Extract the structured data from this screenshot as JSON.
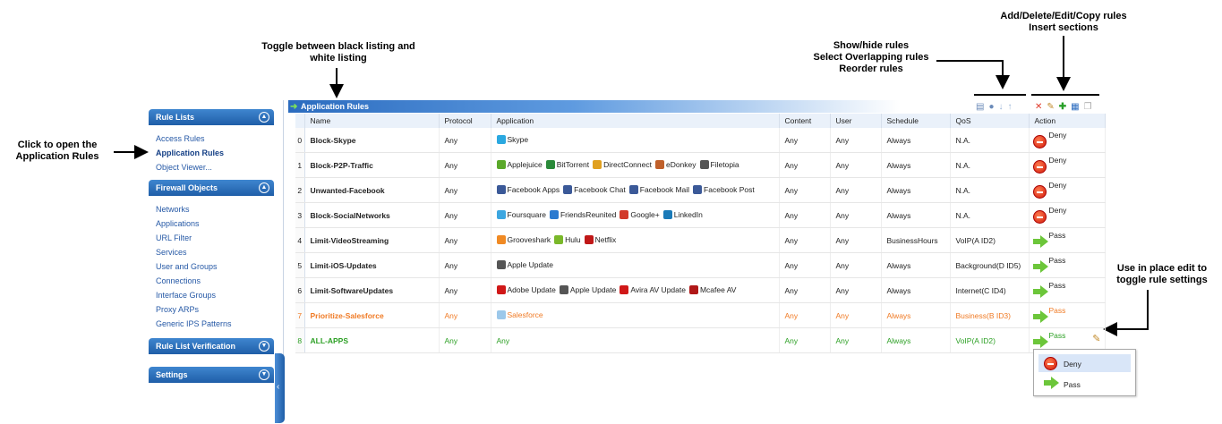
{
  "callouts": {
    "toggle_listing": "Toggle between black listing and white listing",
    "open_rules": "Click to open the Application Rules",
    "show_hide": "Show/hide rules",
    "select_overlap": "Select Overlapping rules",
    "reorder": "Reorder rules",
    "add_delete": "Add/Delete/Edit/Copy rules",
    "insert_sections": "Insert sections",
    "in_place_edit": "Use in place edit to toggle rule settings"
  },
  "sidebar": {
    "sections": [
      {
        "title": "Rule Lists",
        "items": [
          "Access Rules",
          "Application Rules",
          "Object Viewer..."
        ],
        "active": "Application Rules"
      },
      {
        "title": "Firewall Objects",
        "items": [
          "Networks",
          "Applications",
          "URL Filter",
          "Services",
          "User and Groups",
          "Connections",
          "Interface Groups",
          "Proxy ARPs",
          "Generic IPS Patterns"
        ]
      },
      {
        "title": "Rule List Verification",
        "items": []
      },
      {
        "title": "Settings",
        "items": []
      }
    ]
  },
  "panel": {
    "title": "Application Rules",
    "columns": [
      "Name",
      "Protocol",
      "Application",
      "Content",
      "User",
      "Schedule",
      "QoS",
      "Action"
    ]
  },
  "rules": [
    {
      "idx": "0",
      "name": "Block-Skype",
      "protocol": "Any",
      "apps": [
        {
          "label": "Skype",
          "icon": "skype-icon",
          "color": "#2aa8e0"
        }
      ],
      "content": "Any",
      "user": "Any",
      "schedule": "Always",
      "qos": "N.A.",
      "action": "Deny"
    },
    {
      "idx": "1",
      "name": "Block-P2P-Traffic",
      "protocol": "Any",
      "apps": [
        {
          "label": "Applejuice",
          "icon": "applejuice-icon",
          "color": "#5aa82a"
        },
        {
          "label": "BitTorrent",
          "icon": "bittorrent-icon",
          "color": "#2a8a3a"
        },
        {
          "label": "DirectConnect",
          "icon": "directconnect-icon",
          "color": "#e0a020"
        },
        {
          "label": "eDonkey",
          "icon": "edonkey-icon",
          "color": "#c0602a"
        },
        {
          "label": "Filetopia",
          "icon": "filetopia-icon",
          "color": "#555555"
        }
      ],
      "content": "Any",
      "user": "Any",
      "schedule": "Always",
      "qos": "N.A.",
      "action": "Deny"
    },
    {
      "idx": "2",
      "name": "Unwanted-Facebook",
      "protocol": "Any",
      "apps": [
        {
          "label": "Facebook Apps",
          "icon": "facebook-icon",
          "color": "#3b5998"
        },
        {
          "label": "Facebook Chat",
          "icon": "facebook-icon",
          "color": "#3b5998"
        },
        {
          "label": "Facebook Mail",
          "icon": "facebook-icon",
          "color": "#3b5998"
        },
        {
          "label": "Facebook Post",
          "icon": "facebook-icon",
          "color": "#3b5998"
        }
      ],
      "content": "Any",
      "user": "Any",
      "schedule": "Always",
      "qos": "N.A.",
      "action": "Deny"
    },
    {
      "idx": "3",
      "name": "Block-SocialNetworks",
      "protocol": "Any",
      "apps": [
        {
          "label": "Foursquare",
          "icon": "foursquare-icon",
          "color": "#3ca6e0"
        },
        {
          "label": "FriendsReunited",
          "icon": "friendsreunited-icon",
          "color": "#2a7ad0"
        },
        {
          "label": "Google+",
          "icon": "googleplus-icon",
          "color": "#d23a2a"
        },
        {
          "label": "LinkedIn",
          "icon": "linkedin-icon",
          "color": "#1a7ab8"
        }
      ],
      "content": "Any",
      "user": "Any",
      "schedule": "Always",
      "qos": "N.A.",
      "action": "Deny"
    },
    {
      "idx": "4",
      "name": "Limit-VideoStreaming",
      "protocol": "Any",
      "apps": [
        {
          "label": "Grooveshark",
          "icon": "grooveshark-icon",
          "color": "#f08a24"
        },
        {
          "label": "Hulu",
          "icon": "hulu-icon",
          "color": "#7ab82a"
        },
        {
          "label": "Netflix",
          "icon": "netflix-icon",
          "color": "#c01818"
        }
      ],
      "content": "Any",
      "user": "Any",
      "schedule": "BusinessHours",
      "qos": "VoIP(A ID2)",
      "action": "Pass"
    },
    {
      "idx": "5",
      "name": "Limit-iOS-Updates",
      "protocol": "Any",
      "apps": [
        {
          "label": "Apple Update",
          "icon": "apple-icon",
          "color": "#555555"
        }
      ],
      "content": "Any",
      "user": "Any",
      "schedule": "Always",
      "qos": "Background(D ID5)",
      "action": "Pass"
    },
    {
      "idx": "6",
      "name": "Limit-SoftwareUpdates",
      "protocol": "Any",
      "apps": [
        {
          "label": "Adobe Update",
          "icon": "adobe-icon",
          "color": "#d01818"
        },
        {
          "label": "Apple Update",
          "icon": "apple-icon",
          "color": "#555555"
        },
        {
          "label": "Avira AV Update",
          "icon": "avira-icon",
          "color": "#d01818"
        },
        {
          "label": "Mcafee AV",
          "icon": "mcafee-icon",
          "color": "#b01818"
        }
      ],
      "content": "Any",
      "user": "Any",
      "schedule": "Always",
      "qos": "Internet(C ID4)",
      "action": "Pass"
    },
    {
      "idx": "7",
      "name": "Prioritize-Salesforce",
      "protocol": "Any",
      "apps": [
        {
          "label": "Salesforce",
          "icon": "salesforce-icon",
          "color": "#9cc8ea"
        }
      ],
      "content": "Any",
      "user": "Any",
      "schedule": "Always",
      "qos": "Business(B ID3)",
      "action": "Pass",
      "color": "orange"
    },
    {
      "idx": "8",
      "name": "ALL-APPS",
      "protocol": "Any",
      "apps": [
        {
          "label": "Any",
          "icon": "",
          "color": ""
        }
      ],
      "content": "Any",
      "user": "Any",
      "schedule": "Always",
      "qos": "VoIP(A ID2)",
      "action": "Pass",
      "color": "green"
    }
  ],
  "dropdown": {
    "options": [
      "Deny",
      "Pass"
    ],
    "selected": "Deny"
  }
}
